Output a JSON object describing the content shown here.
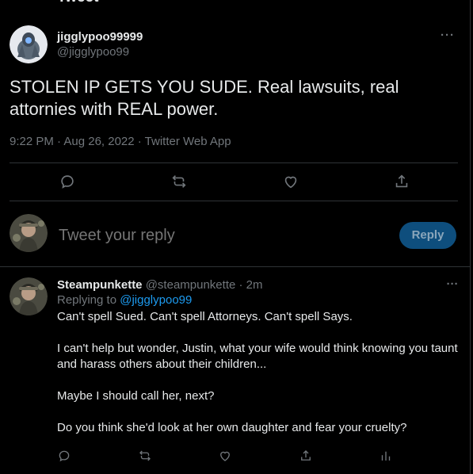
{
  "header": {
    "title": "Tweet"
  },
  "tweet": {
    "display_name": "jigglypoo99999",
    "handle": "@jigglypoo99",
    "text": "STOLEN IP GETS YOU SUDE. Real lawsuits, real attornies with REAL power.",
    "meta": "9:22 PM · Aug 26, 2022 · Twitter Web App",
    "actions": [
      "reply-icon",
      "retweet-icon",
      "like-icon",
      "share-icon"
    ]
  },
  "composer": {
    "placeholder": "Tweet your reply",
    "button_label": "Reply"
  },
  "reply": {
    "display_name": "Steampunkette",
    "handle": "@steampunkette",
    "separator": "·",
    "time": "2m",
    "replying_prefix": "Replying to ",
    "replying_to": "@jigglypoo99",
    "text": "Can't spell Sued. Can't spell Attorneys. Can't spell Says.\n\nI can't help but wonder, Justin, what your wife would think knowing you taunt and harass others about their children...\n\nMaybe I should call her, next?\n\nDo you think she'd look at her own daughter and fear your cruelty?",
    "actions": [
      "reply-icon",
      "retweet-icon",
      "like-icon",
      "share-icon",
      "analytics-icon"
    ]
  },
  "colors": {
    "background": "#000000",
    "text": "#e7e9ea",
    "secondary": "#71767b",
    "accent": "#1d9bf0",
    "border": "#2f3336"
  }
}
